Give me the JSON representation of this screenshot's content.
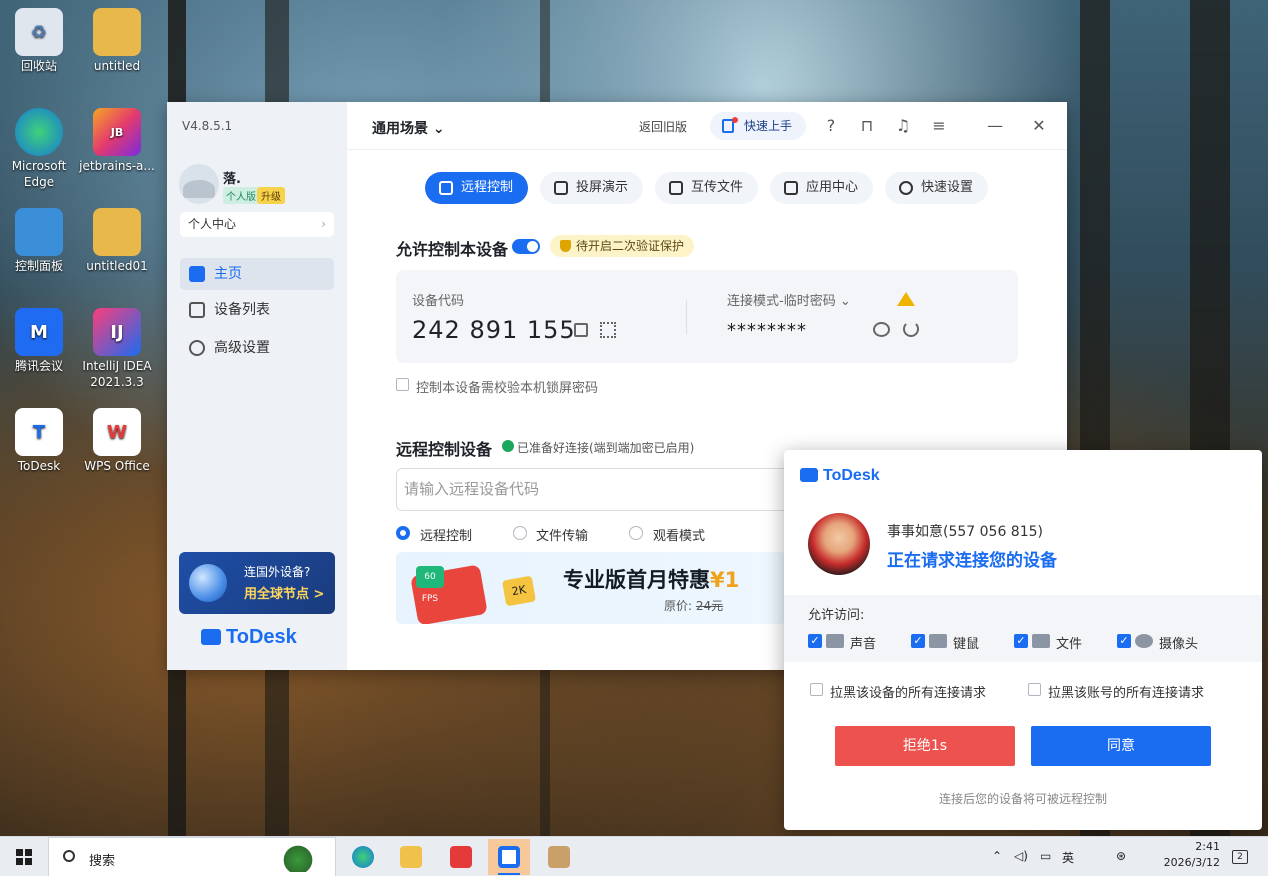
{
  "desktop": {
    "icons": [
      {
        "label": "回收站"
      },
      {
        "label": "untitled"
      },
      {
        "label": "Microsoft Edge"
      },
      {
        "label": "jetbrains-a..."
      },
      {
        "label": "控制面板"
      },
      {
        "label": "untitled01"
      },
      {
        "label": "腾讯会议"
      },
      {
        "label": "IntelliJ IDEA 2021.3.3"
      },
      {
        "label": "ToDesk"
      },
      {
        "label": "WPS Office"
      }
    ]
  },
  "main_window": {
    "version": "V4.8.5.1",
    "user": {
      "name": "落.",
      "plan_badge": "个人版",
      "upgrade_badge": "升级"
    },
    "personal_center": "个人中心",
    "nav": [
      {
        "label": "主页",
        "icon": "home-icon"
      },
      {
        "label": "设备列表",
        "icon": "devices-icon"
      },
      {
        "label": "高级设置",
        "icon": "gear-icon"
      }
    ],
    "promo": {
      "line1": "连国外设备?",
      "line2": "用全球节点 >"
    },
    "brand": "ToDesk",
    "topbar": {
      "scene": "通用场景",
      "back_to_old": "返回旧版",
      "quick_start": "快速上手"
    },
    "tabs": [
      {
        "label": "远程控制",
        "icon": "monitor-icon"
      },
      {
        "label": "投屏演示",
        "icon": "cast-icon"
      },
      {
        "label": "互传文件",
        "icon": "file-transfer-icon"
      },
      {
        "label": "应用中心",
        "icon": "apps-icon"
      },
      {
        "label": "快速设置",
        "icon": "settings-icon"
      }
    ],
    "allow_control": {
      "title": "允许控制本设备",
      "toggle_on": true,
      "verify_badge": "待开启二次验证保护",
      "device_code_label": "设备代码",
      "device_code": "242 891 155",
      "mode_label": "连接模式-临时密码",
      "password": "********",
      "lock_check_label": "控制本设备需校验本机锁屏密码"
    },
    "remote_control": {
      "title": "远程控制设备",
      "ready_text": "已准备好连接(端到端加密已启用)",
      "input_placeholder": "请输入远程设备代码",
      "modes": [
        {
          "label": "远程控制",
          "selected": true
        },
        {
          "label": "文件传输",
          "selected": false
        },
        {
          "label": "观看模式",
          "selected": false
        }
      ],
      "banner": {
        "fps": "60 FPS",
        "res": "2K",
        "title_main": "专业版首月特惠",
        "title_price": "¥1",
        "original_label": "原价:",
        "original_price": "24元"
      }
    }
  },
  "popup": {
    "brand": "ToDesk",
    "requester": "事事如意(557 056 815)",
    "message": "正在请求连接您的设备",
    "allow_label": "允许访问:",
    "permissions": [
      {
        "label": "声音",
        "checked": true
      },
      {
        "label": "键鼠",
        "checked": true
      },
      {
        "label": "文件",
        "checked": true
      },
      {
        "label": "摄像头",
        "checked": true
      }
    ],
    "block_device": "拉黑该设备的所有连接请求",
    "block_account": "拉黑该账号的所有连接请求",
    "reject": "拒绝1s",
    "accept": "同意",
    "footer": "连接后您的设备将可被远程控制"
  },
  "taskbar": {
    "search": "搜索",
    "time": "2:41",
    "date": "2026/3/12",
    "notification_count": "2"
  }
}
